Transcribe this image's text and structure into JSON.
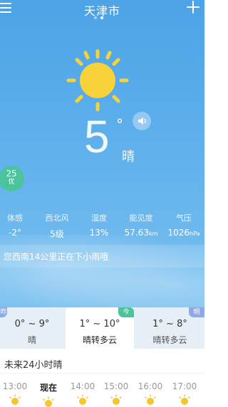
{
  "header": {
    "city": "天津市",
    "menu_icon": "menu-icon",
    "add_icon": "add-icon",
    "page_dots": 2,
    "active_dot": 1
  },
  "current": {
    "icon": "sun-icon",
    "temperature": "5",
    "degree_symbol": "°",
    "condition": "晴",
    "speaker_icon": "speaker-icon"
  },
  "aqi": {
    "value": "25",
    "level": "优",
    "color": "#4cc49b"
  },
  "metrics": [
    {
      "label": "体感",
      "value": "-2°",
      "unit": ""
    },
    {
      "label": "西北风",
      "value": "5级",
      "unit": ""
    },
    {
      "label": "湿度",
      "value": "13%",
      "unit": ""
    },
    {
      "label": "能见度",
      "value": "57.63",
      "unit": "km"
    },
    {
      "label": "气压",
      "value": "1026",
      "unit": "hPa"
    }
  ],
  "rain_notice": "您西南14公里正在下小雨哦",
  "days": [
    {
      "tag": "昨",
      "range": "0° ~ 9°",
      "desc": "晴"
    },
    {
      "tag": "今",
      "range": "1° ~ 10°",
      "desc": "晴转多云"
    },
    {
      "tag": "明",
      "range": "1° ~ 8°",
      "desc": "晴转多云"
    }
  ],
  "hourly": {
    "title": "未来24小时晴",
    "hours": [
      {
        "time": "13:00",
        "icon": "sun-icon",
        "current": false
      },
      {
        "time": "现在",
        "icon": "sun-icon",
        "current": true
      },
      {
        "time": "14:00",
        "icon": "sun-icon",
        "current": false
      },
      {
        "time": "15:00",
        "icon": "sun-icon",
        "current": false
      },
      {
        "time": "16:00",
        "icon": "sun-icon",
        "current": false
      },
      {
        "time": "17:00",
        "icon": "sun-icon",
        "current": false
      }
    ]
  },
  "colors": {
    "sky_top": "#4da3e6",
    "sun": "#f7d23b",
    "today_tag": "#4cc49b",
    "tomorrow_tag": "#8fa9e6",
    "yesterday_tag": "#8fa9e6"
  }
}
